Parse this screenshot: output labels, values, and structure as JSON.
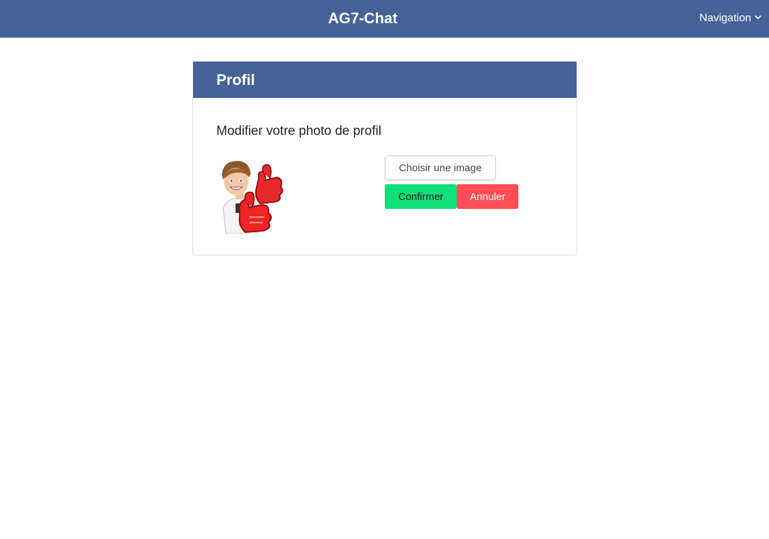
{
  "navbar": {
    "brand": "AG7-Chat",
    "menu_label": "Navigation",
    "menu_icon": "chevron-down-icon",
    "background": "#456299"
  },
  "profile_card": {
    "title": "Profil",
    "subtitle": "Modifier votre photo de profil",
    "avatar": "bitmoji-avatar-thumbs-up",
    "choose_image_label": "Choisir une image",
    "confirm_label": "Confirmer",
    "cancel_label": "Annuler",
    "colors": {
      "header": "#456299",
      "confirm": "#10e07a",
      "cancel": "#ff4f55"
    }
  }
}
